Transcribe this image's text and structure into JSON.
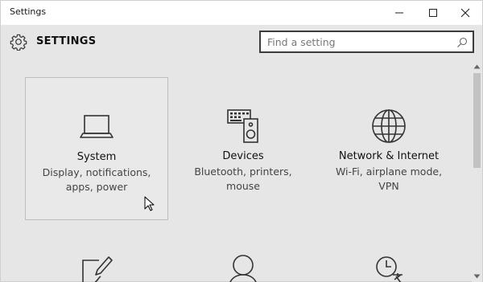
{
  "window": {
    "title": "Settings"
  },
  "titlebar": {
    "minimize_icon": "minimize-icon",
    "maximize_icon": "maximize-icon",
    "close_icon": "close-icon"
  },
  "header": {
    "heading": "SETTINGS",
    "icon": "gear-icon"
  },
  "search": {
    "placeholder": "Find a setting",
    "value": "",
    "icon": "search-icon"
  },
  "tiles": [
    {
      "name": "System",
      "description": "Display, notifications, apps, power",
      "desc_line1": "Display, notifications,",
      "desc_line2": "apps, power",
      "icon": "laptop-icon",
      "selected": true
    },
    {
      "name": "Devices",
      "description": "Bluetooth, printers, mouse",
      "desc_line1": "Bluetooth, printers,",
      "desc_line2": "mouse",
      "icon": "keyboard-speaker-icon",
      "selected": false
    },
    {
      "name": "Network & Internet",
      "description": "Wi-Fi, airplane mode, VPN",
      "desc_line1": "Wi-Fi, airplane mode,",
      "desc_line2": "VPN",
      "icon": "globe-icon",
      "selected": false
    }
  ],
  "partial_tiles": [
    {
      "icon": "personalization-pen-icon"
    },
    {
      "icon": "person-icon"
    },
    {
      "icon": "time-language-icon"
    }
  ],
  "colors": {
    "background": "#e6e6e6",
    "titlebar": "#ffffff",
    "icon_stroke": "#333333",
    "selected_border": "#bdbdbd",
    "search_border": "#3c3c3c"
  }
}
